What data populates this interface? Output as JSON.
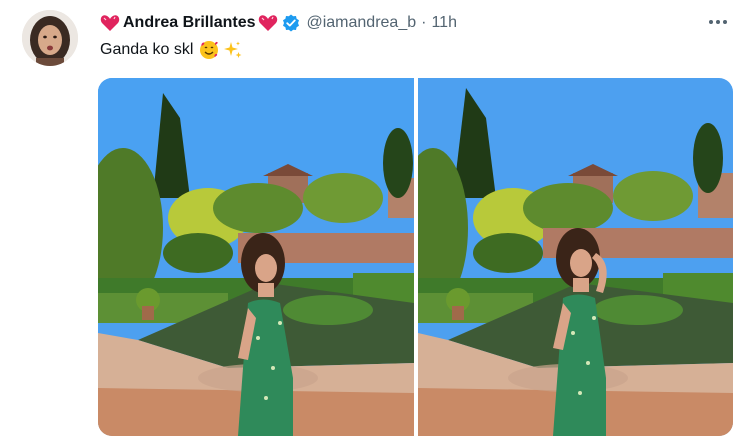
{
  "tweet": {
    "author_name": "Andrea Brillantes",
    "handle": "@iamandrea_b",
    "separator": "·",
    "time": "11h",
    "text": "Ganda ko skl",
    "heart_icon": "heart-emoji",
    "verified_icon": "verified-badge-icon",
    "text_emojis": [
      "smiling-face-with-hearts-emoji",
      "sparkles-emoji"
    ],
    "more_icon": "more-icon"
  },
  "media": {
    "photos": [
      {
        "subject": "photo-1"
      },
      {
        "subject": "photo-2"
      }
    ]
  },
  "colors": {
    "verified": "#1d9bf0",
    "heart": "#e0245e",
    "secondary_text": "#536471",
    "sky": "#4da0f0"
  }
}
